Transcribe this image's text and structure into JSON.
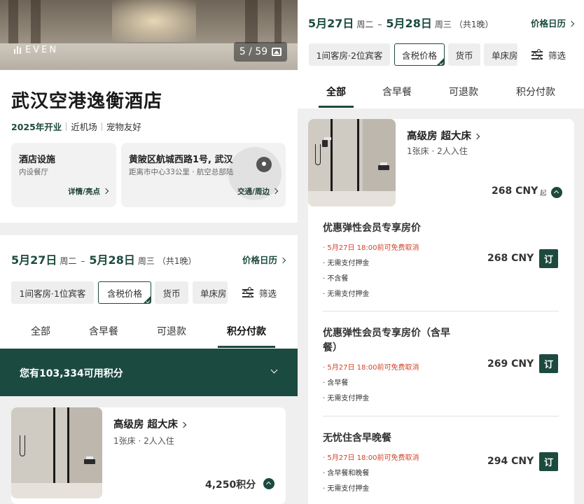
{
  "hero": {
    "brand": "EVEN",
    "photo_counter": "5 / 59"
  },
  "hotel": {
    "name": "武汉空港逸衡酒店",
    "tags": [
      "2025年开业",
      "近机场",
      "宠物友好"
    ]
  },
  "facilities_card": {
    "title": "酒店设施",
    "subtitle": "内设餐厅",
    "link": "详情/亮点"
  },
  "address_card": {
    "title": "黄陂区航城西路1号, 武汉",
    "subtitle": "距离市中心33公里 · 航空总部陆",
    "link": "交通/周边"
  },
  "stay": {
    "checkin_date": "5月27日",
    "checkin_weekday": "周二",
    "dash": "–",
    "checkout_date": "5月28日",
    "checkout_weekday": "周三",
    "nights": "（共1晚）",
    "price_calendar": "价格日历"
  },
  "left_filters": {
    "guests": "1间客房·1位宾客",
    "tax": "含税价格",
    "currency": "货币",
    "bed": "单床房",
    "filter": "筛选"
  },
  "right_filters": {
    "guests": "1间客房·2位宾客",
    "tax": "含税价格",
    "currency": "货币",
    "bed": "单床房",
    "filter": "筛选"
  },
  "tabs": [
    "全部",
    "含早餐",
    "可退款",
    "积分付款"
  ],
  "left_active_tab": "积分付款",
  "right_active_tab": "全部",
  "points_banner": "您有103,334可用积分",
  "left_room": {
    "name": "高级房 超大床",
    "sub": "1张床 · 2人入住",
    "price": "4,250积分"
  },
  "right_room": {
    "name": "高级房 超大床",
    "sub": "1张床 · 2人入住",
    "price": "268 CNY",
    "from": "起"
  },
  "rates": [
    {
      "name": "优惠弹性会员专享房价",
      "cancel": "· 5月27日 18:00前可免费取消",
      "bullets": [
        "· 无需支付押金",
        "· 不含餐",
        "· 无需支付押金"
      ],
      "price": "268 CNY",
      "book": "订"
    },
    {
      "name": "优惠弹性会员专享房价（含早餐）",
      "cancel": "· 5月27日 18:00前可免费取消",
      "bullets": [
        "· 含早餐",
        "· 无需支付押金"
      ],
      "price": "269 CNY",
      "book": "订"
    },
    {
      "name": "无忧住含早晚餐",
      "cancel": "· 5月27日 18:00前可免费取消",
      "bullets": [
        "· 含早餐和晚餐",
        "· 无需支付押金"
      ],
      "price": "294 CNY",
      "book": "订"
    }
  ],
  "colors": {
    "brand_green": "#1c4a3f",
    "cancel_red": "#d0432b",
    "banner_green": "#1b4a40"
  }
}
